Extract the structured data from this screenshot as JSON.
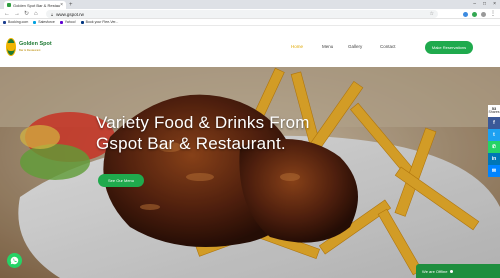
{
  "browser": {
    "tab_title": "Golden Spot Bar & Restau",
    "url": "www.gspot.rw",
    "bookmarks": [
      "Booking.com",
      "Salesforce",
      "Yahoo!",
      "Book your Flee-Ver..."
    ]
  },
  "site": {
    "logo_title": "Golden Spot",
    "logo_subtitle": "Bar & Restaurant",
    "menu": [
      "Home",
      "Menu",
      "Gallery",
      "Contact"
    ],
    "reserve_label": "Make Reservations"
  },
  "hero": {
    "title_line1": "Variety Food & Drinks From",
    "title_line2": "Gspot Bar & Restaurant.",
    "button_label": "See Our Menu"
  },
  "share": {
    "count": "53",
    "count_label": "Shares"
  },
  "chat": {
    "label": "We are Offline"
  },
  "colors": {
    "brand_green": "#1faa4d",
    "active_menu": "#e0a800"
  }
}
